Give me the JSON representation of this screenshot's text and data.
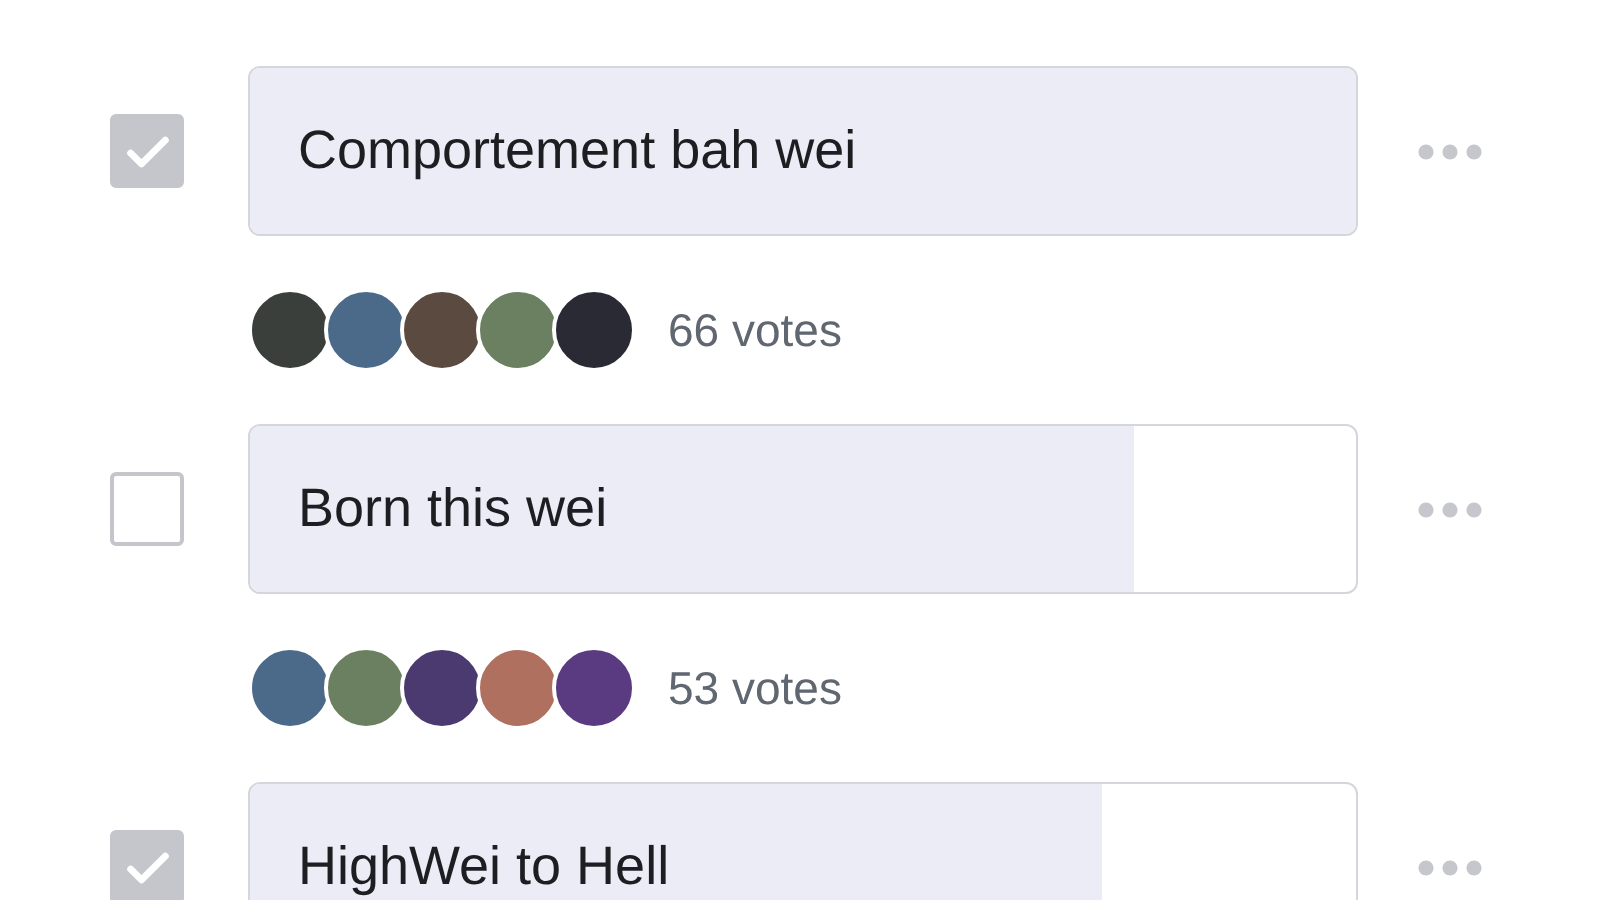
{
  "poll_options": [
    {
      "text": "Comportement bah wei",
      "checked": true,
      "level": 1.0,
      "votes": "66 votes"
    },
    {
      "text": "Born this wei",
      "checked": false,
      "level": 0.8,
      "votes": "53 votes"
    },
    {
      "text": "HighWei to Hell",
      "checked": true,
      "level": 0.77
    }
  ]
}
